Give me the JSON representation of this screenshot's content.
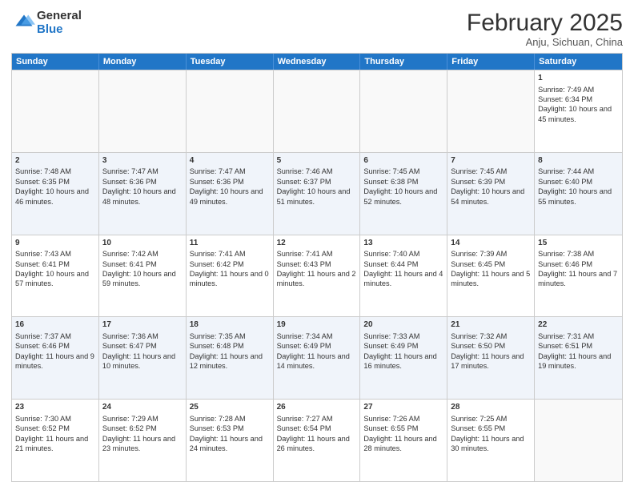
{
  "header": {
    "logo_general": "General",
    "logo_blue": "Blue",
    "month_title": "February 2025",
    "subtitle": "Anju, Sichuan, China"
  },
  "weekdays": [
    "Sunday",
    "Monday",
    "Tuesday",
    "Wednesday",
    "Thursday",
    "Friday",
    "Saturday"
  ],
  "rows": [
    [
      {
        "day": "",
        "info": ""
      },
      {
        "day": "",
        "info": ""
      },
      {
        "day": "",
        "info": ""
      },
      {
        "day": "",
        "info": ""
      },
      {
        "day": "",
        "info": ""
      },
      {
        "day": "",
        "info": ""
      },
      {
        "day": "1",
        "info": "Sunrise: 7:49 AM\nSunset: 6:34 PM\nDaylight: 10 hours and 45 minutes."
      }
    ],
    [
      {
        "day": "2",
        "info": "Sunrise: 7:48 AM\nSunset: 6:35 PM\nDaylight: 10 hours and 46 minutes."
      },
      {
        "day": "3",
        "info": "Sunrise: 7:47 AM\nSunset: 6:36 PM\nDaylight: 10 hours and 48 minutes."
      },
      {
        "day": "4",
        "info": "Sunrise: 7:47 AM\nSunset: 6:36 PM\nDaylight: 10 hours and 49 minutes."
      },
      {
        "day": "5",
        "info": "Sunrise: 7:46 AM\nSunset: 6:37 PM\nDaylight: 10 hours and 51 minutes."
      },
      {
        "day": "6",
        "info": "Sunrise: 7:45 AM\nSunset: 6:38 PM\nDaylight: 10 hours and 52 minutes."
      },
      {
        "day": "7",
        "info": "Sunrise: 7:45 AM\nSunset: 6:39 PM\nDaylight: 10 hours and 54 minutes."
      },
      {
        "day": "8",
        "info": "Sunrise: 7:44 AM\nSunset: 6:40 PM\nDaylight: 10 hours and 55 minutes."
      }
    ],
    [
      {
        "day": "9",
        "info": "Sunrise: 7:43 AM\nSunset: 6:41 PM\nDaylight: 10 hours and 57 minutes."
      },
      {
        "day": "10",
        "info": "Sunrise: 7:42 AM\nSunset: 6:41 PM\nDaylight: 10 hours and 59 minutes."
      },
      {
        "day": "11",
        "info": "Sunrise: 7:41 AM\nSunset: 6:42 PM\nDaylight: 11 hours and 0 minutes."
      },
      {
        "day": "12",
        "info": "Sunrise: 7:41 AM\nSunset: 6:43 PM\nDaylight: 11 hours and 2 minutes."
      },
      {
        "day": "13",
        "info": "Sunrise: 7:40 AM\nSunset: 6:44 PM\nDaylight: 11 hours and 4 minutes."
      },
      {
        "day": "14",
        "info": "Sunrise: 7:39 AM\nSunset: 6:45 PM\nDaylight: 11 hours and 5 minutes."
      },
      {
        "day": "15",
        "info": "Sunrise: 7:38 AM\nSunset: 6:46 PM\nDaylight: 11 hours and 7 minutes."
      }
    ],
    [
      {
        "day": "16",
        "info": "Sunrise: 7:37 AM\nSunset: 6:46 PM\nDaylight: 11 hours and 9 minutes."
      },
      {
        "day": "17",
        "info": "Sunrise: 7:36 AM\nSunset: 6:47 PM\nDaylight: 11 hours and 10 minutes."
      },
      {
        "day": "18",
        "info": "Sunrise: 7:35 AM\nSunset: 6:48 PM\nDaylight: 11 hours and 12 minutes."
      },
      {
        "day": "19",
        "info": "Sunrise: 7:34 AM\nSunset: 6:49 PM\nDaylight: 11 hours and 14 minutes."
      },
      {
        "day": "20",
        "info": "Sunrise: 7:33 AM\nSunset: 6:49 PM\nDaylight: 11 hours and 16 minutes."
      },
      {
        "day": "21",
        "info": "Sunrise: 7:32 AM\nSunset: 6:50 PM\nDaylight: 11 hours and 17 minutes."
      },
      {
        "day": "22",
        "info": "Sunrise: 7:31 AM\nSunset: 6:51 PM\nDaylight: 11 hours and 19 minutes."
      }
    ],
    [
      {
        "day": "23",
        "info": "Sunrise: 7:30 AM\nSunset: 6:52 PM\nDaylight: 11 hours and 21 minutes."
      },
      {
        "day": "24",
        "info": "Sunrise: 7:29 AM\nSunset: 6:52 PM\nDaylight: 11 hours and 23 minutes."
      },
      {
        "day": "25",
        "info": "Sunrise: 7:28 AM\nSunset: 6:53 PM\nDaylight: 11 hours and 24 minutes."
      },
      {
        "day": "26",
        "info": "Sunrise: 7:27 AM\nSunset: 6:54 PM\nDaylight: 11 hours and 26 minutes."
      },
      {
        "day": "27",
        "info": "Sunrise: 7:26 AM\nSunset: 6:55 PM\nDaylight: 11 hours and 28 minutes."
      },
      {
        "day": "28",
        "info": "Sunrise: 7:25 AM\nSunset: 6:55 PM\nDaylight: 11 hours and 30 minutes."
      },
      {
        "day": "",
        "info": ""
      }
    ]
  ]
}
